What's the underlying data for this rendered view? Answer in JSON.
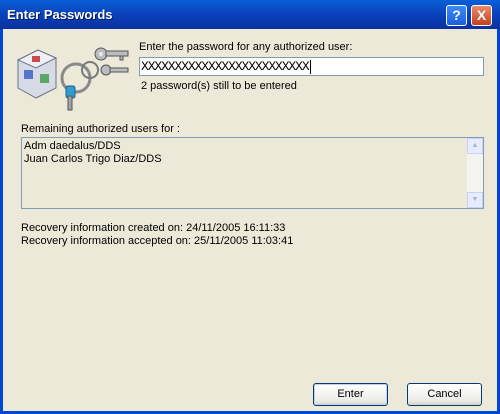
{
  "window": {
    "title": "Enter Passwords",
    "help_glyph": "?",
    "close_glyph": "X"
  },
  "prompt": {
    "label": "Enter the password for any authorized user:",
    "password_value": "XXXXXXXXXXXXXXXXXXXXXXXXX",
    "status": "2 password(s) still to be entered"
  },
  "users": {
    "label": "Remaining authorized users for :",
    "items": [
      "Adm daedalus/DDS",
      "Juan Carlos Trigo Diaz/DDS"
    ]
  },
  "recovery": {
    "created": "Recovery information created on: 24/11/2005 16:11:33",
    "accepted": "Recovery information accepted on: 25/11/2005 11:03:41"
  },
  "buttons": {
    "enter": "Enter",
    "cancel": "Cancel"
  },
  "icons": {
    "app": "keyring-icon"
  }
}
